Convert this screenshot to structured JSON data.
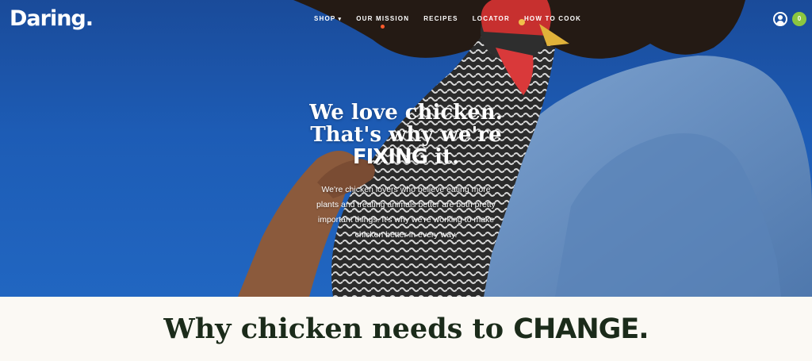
{
  "brand": {
    "logo_text": "Daring."
  },
  "nav": {
    "items": [
      {
        "label": "SHOP",
        "has_dropdown": true
      },
      {
        "label": "OUR MISSION",
        "active": true
      },
      {
        "label": "RECIPES"
      },
      {
        "label": "LOCATOR"
      },
      {
        "label": "HOW TO COOK"
      }
    ]
  },
  "header_actions": {
    "account_icon": "user-icon",
    "cart_count": "0"
  },
  "hero": {
    "headline_line1": "We love chicken.",
    "headline_line2": "That's why we're",
    "headline_strong": "FIXING",
    "headline_rest": " it.",
    "subcopy": "We're chicken lovers who believe eating more plants and treating animals better are both pretty important things. It's why we're working to make chicken better in every way."
  },
  "section": {
    "title_prefix": "Why chicken needs to ",
    "title_strong": "CHANGE."
  },
  "colors": {
    "sky": "#1d5cb5",
    "sweatshirt": "#6f95c4",
    "cart_badge": "#8cc63f",
    "active_dot": "#ff5a2c",
    "section_bg": "#fbf9f4",
    "title_text": "#1b2b1a"
  }
}
